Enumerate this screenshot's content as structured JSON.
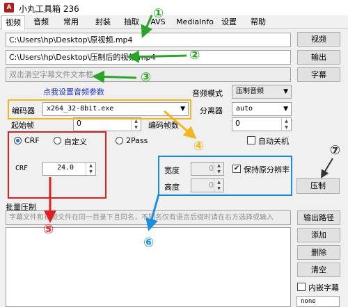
{
  "window": {
    "title": "小丸工具箱 236",
    "icon_label": "A"
  },
  "tabs": [
    {
      "label": "视频"
    },
    {
      "label": "音频"
    },
    {
      "label": "常用"
    },
    {
      "label": "封装"
    },
    {
      "label": "抽取"
    },
    {
      "label": "AVS"
    },
    {
      "label": "MediaInfo"
    },
    {
      "label": "设置"
    },
    {
      "label": "帮助"
    }
  ],
  "files": {
    "source_value": "C:\\Users\\hp\\Desktop\\原视频.mp4",
    "source_button": "视频",
    "output_value": "C:\\Users\\hp\\Desktop\\压制后的视频.mp4",
    "output_button": "输出",
    "subtitle_placeholder": "双击清空字幕文件文本框",
    "subtitle_button": "字幕"
  },
  "audio": {
    "settings_link": "点我设置音频参数",
    "mode_label": "音频模式",
    "mode_value": "压制音频"
  },
  "encoder": {
    "label": "编码器",
    "value": "x264_32-8bit.exe",
    "demuxer_label": "分离器",
    "demuxer_value": "auto",
    "start_frame_label": "起始帧",
    "start_frame_value": "0",
    "encode_frames_label": "编码帧数",
    "encode_frames_value": "0"
  },
  "rate": {
    "crf_label": "CRF",
    "custom_label": "自定义",
    "twopass_label": "2Pass",
    "crf_field_label": "CRF",
    "crf_value": "24.0"
  },
  "shutdown_label": "自动关机",
  "resolution": {
    "width_label": "宽度",
    "width_value": "0",
    "height_label": "高度",
    "height_value": "0",
    "keep_label": "保持原分辨率"
  },
  "compress_button": "压制",
  "batch": {
    "title": "批量压制",
    "hint": "字幕文件和视频文件在同一目录下且同名，不同名仅有语言后缀时请在右方选择或输入",
    "output_path_button": "输出路径",
    "add_button": "添加",
    "delete_button": "删除",
    "clear_button": "清空",
    "embed_sub_label": "内嵌字幕",
    "none_value": "none"
  },
  "annotations": {
    "n1": "①",
    "n2": "②",
    "n3": "③",
    "n4": "④",
    "n5": "⑤",
    "n6": "⑥",
    "n7": "⑦"
  },
  "colors": {
    "green": "#2aa52a",
    "yellow": "#f2b51a",
    "red": "#e02020",
    "blue": "#1a8fe0",
    "link": "#1a33cc"
  }
}
